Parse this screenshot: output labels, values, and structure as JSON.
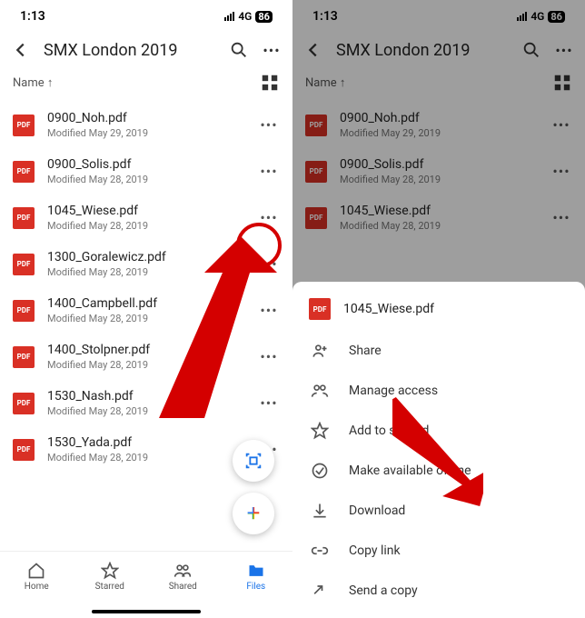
{
  "status": {
    "time": "1:13",
    "net": "4G",
    "battery": "86"
  },
  "folder": {
    "title": "SMX London 2019",
    "sort_label": "Name"
  },
  "files": [
    {
      "name": "0900_Noh.pdf",
      "modified": "Modified May 29, 2019"
    },
    {
      "name": "0900_Solis.pdf",
      "modified": "Modified May 28, 2019"
    },
    {
      "name": "1045_Wiese.pdf",
      "modified": "Modified May 28, 2019"
    },
    {
      "name": "1300_Goralewicz.pdf",
      "modified": "Modified May 28, 2019"
    },
    {
      "name": "1400_Campbell.pdf",
      "modified": "Modified May 28, 2019"
    },
    {
      "name": "1400_Stolpner.pdf",
      "modified": "Modified May 28, 2019"
    },
    {
      "name": "1530_Nash.pdf",
      "modified": "Modified May 28, 2019"
    },
    {
      "name": "1530_Yada.pdf",
      "modified": "Modified May 28, 2019"
    }
  ],
  "pdf_badge": "PDF",
  "nav": {
    "home": "Home",
    "starred": "Starred",
    "shared": "Shared",
    "files": "Files"
  },
  "sheet": {
    "file": "1045_Wiese.pdf",
    "items": {
      "share": "Share",
      "manage": "Manage access",
      "star": "Add to starred",
      "offline": "Make available offline",
      "download": "Download",
      "link": "Copy link",
      "send": "Send a copy"
    }
  }
}
